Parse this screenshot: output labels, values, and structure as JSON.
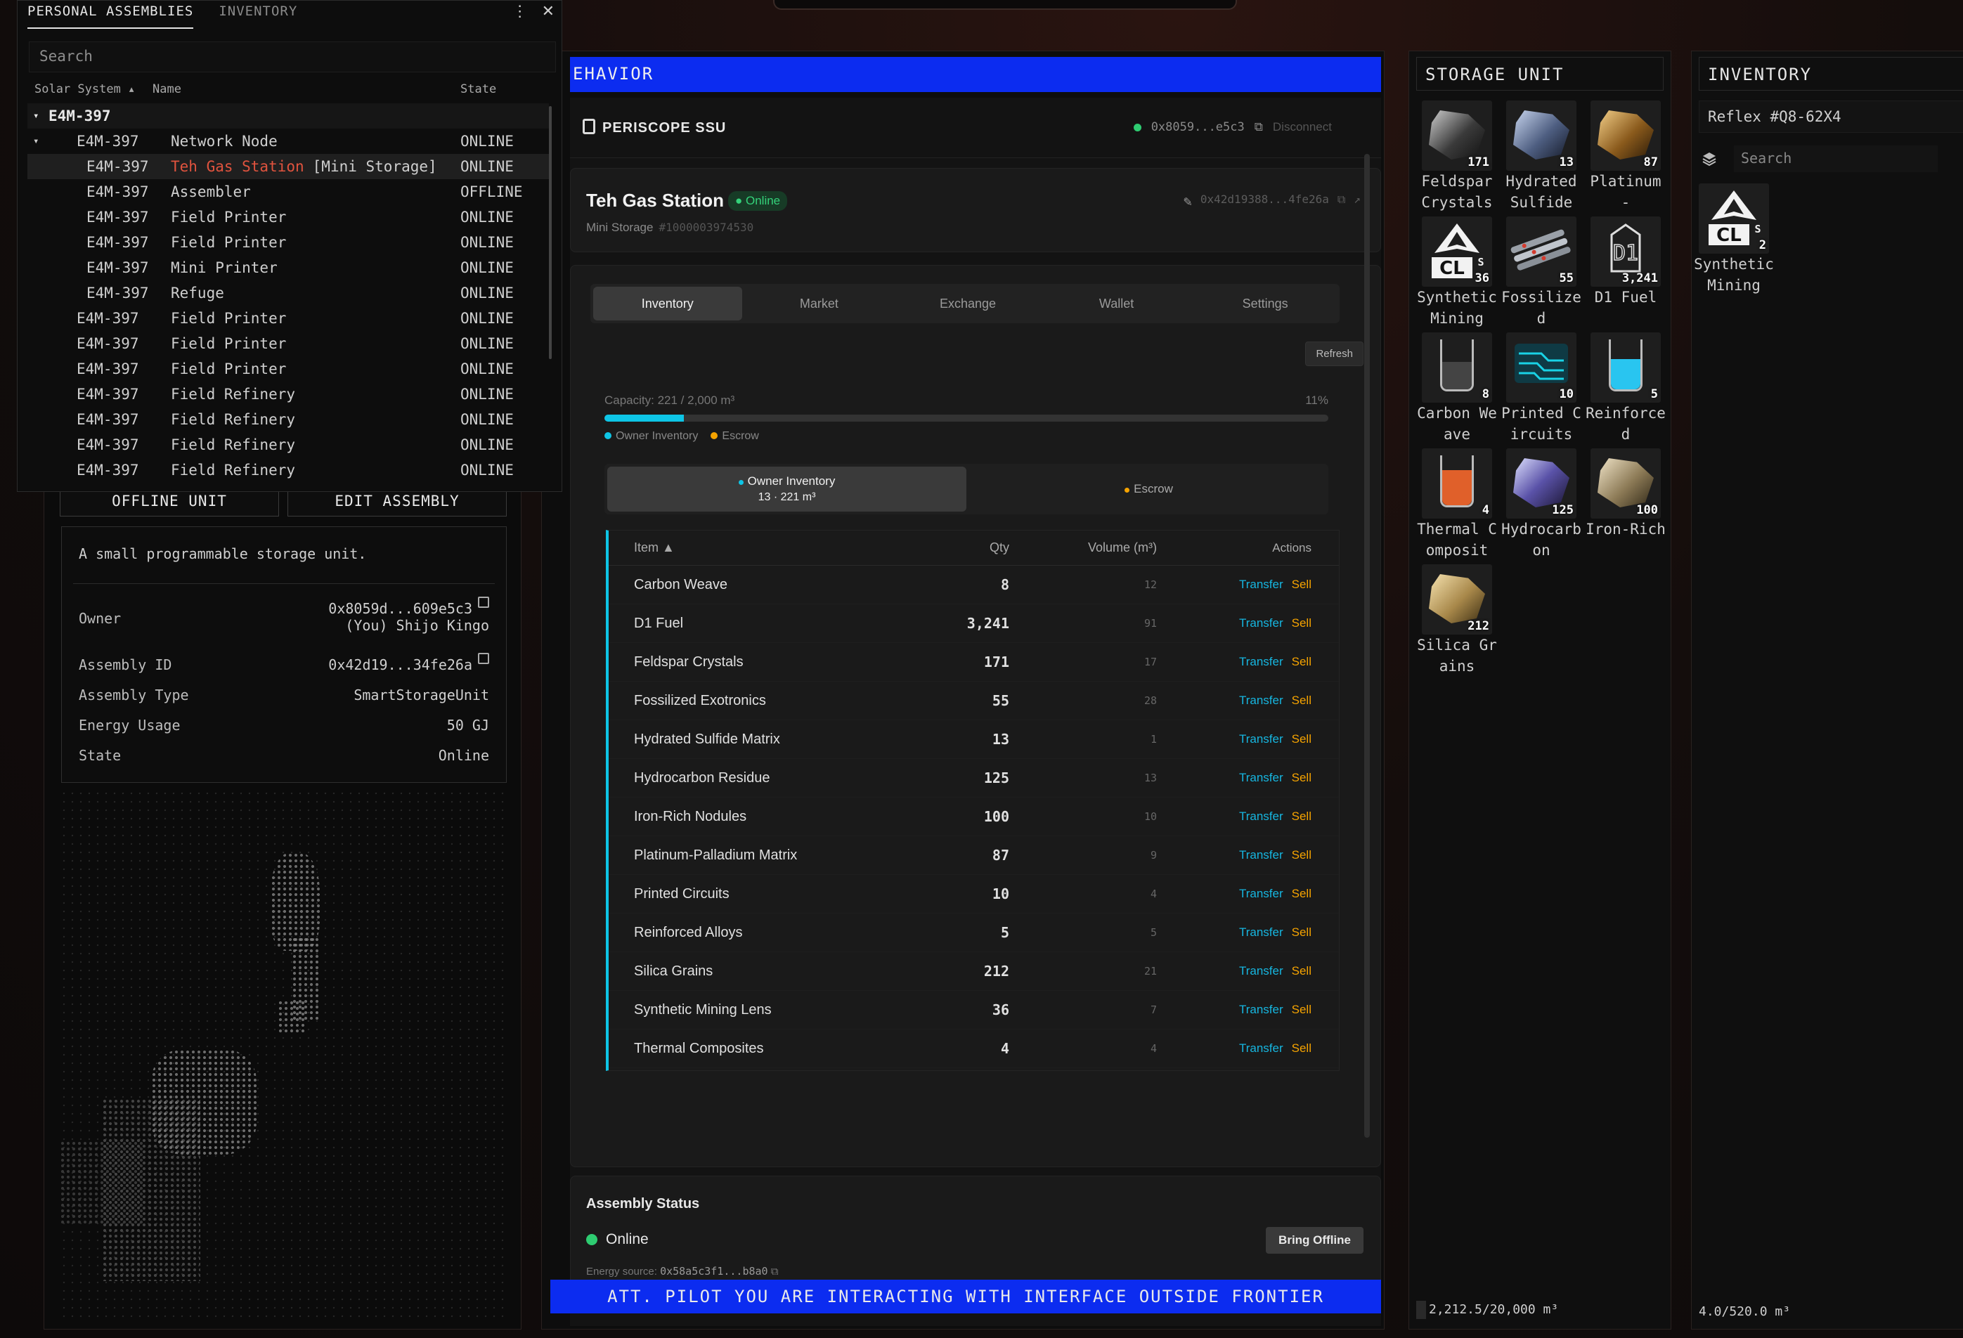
{
  "assemblies_panel": {
    "tabs": [
      "PERSONAL ASSEMBLIES",
      "INVENTORY"
    ],
    "menu_glyph": "⋮",
    "close_glyph": "✕",
    "search_placeholder": "Search",
    "columns": [
      "Solar System ▴",
      "Name",
      "State"
    ],
    "group": "E4M-397",
    "rows": [
      {
        "system": "E4M-397",
        "name": "Network Node",
        "suffix": "",
        "state": "ONLINE",
        "level": 1,
        "expanded": true
      },
      {
        "system": "E4M-397",
        "name": "Teh Gas Station",
        "suffix": "[Mini Storage]",
        "state": "ONLINE",
        "level": 2,
        "selected": true
      },
      {
        "system": "E4M-397",
        "name": "Assembler",
        "suffix": "",
        "state": "OFFLINE",
        "level": 2
      },
      {
        "system": "E4M-397",
        "name": "Field Printer",
        "suffix": "",
        "state": "ONLINE",
        "level": 2
      },
      {
        "system": "E4M-397",
        "name": "Field Printer",
        "suffix": "",
        "state": "ONLINE",
        "level": 2
      },
      {
        "system": "E4M-397",
        "name": "Mini Printer",
        "suffix": "",
        "state": "ONLINE",
        "level": 2
      },
      {
        "system": "E4M-397",
        "name": "Refuge",
        "suffix": "",
        "state": "ONLINE",
        "level": 2
      },
      {
        "system": "E4M-397",
        "name": "Field Printer",
        "suffix": "",
        "state": "ONLINE",
        "level": 1
      },
      {
        "system": "E4M-397",
        "name": "Field Printer",
        "suffix": "",
        "state": "ONLINE",
        "level": 1
      },
      {
        "system": "E4M-397",
        "name": "Field Printer",
        "suffix": "",
        "state": "ONLINE",
        "level": 1
      },
      {
        "system": "E4M-397",
        "name": "Field Refinery",
        "suffix": "",
        "state": "ONLINE",
        "level": 1
      },
      {
        "system": "E4M-397",
        "name": "Field Refinery",
        "suffix": "",
        "state": "ONLINE",
        "level": 1
      },
      {
        "system": "E4M-397",
        "name": "Field Refinery",
        "suffix": "",
        "state": "ONLINE",
        "level": 1
      },
      {
        "system": "E4M-397",
        "name": "Field Refinery",
        "suffix": "",
        "state": "ONLINE",
        "level": 1
      }
    ]
  },
  "left": {
    "offline_unit": "OFFLINE UNIT",
    "edit_assembly": "EDIT ASSEMBLY",
    "description": "A small programmable storage unit.",
    "owner_label": "Owner",
    "owner_addr": "0x8059d...609e5c3",
    "owner_name": "(You) Shijo Kingo",
    "assembly_id_label": "Assembly ID",
    "assembly_id": "0x42d19...34fe26a",
    "assembly_type_label": "Assembly Type",
    "assembly_type": "SmartStorageUnit",
    "energy_label": "Energy Usage",
    "energy": "50 GJ",
    "state_label": "State",
    "state": "Online"
  },
  "center": {
    "behavior_title": "EHAVIOR",
    "dapp_title": "PERISCOPE SSU",
    "wallet_addr": "0x8059...e5c3",
    "disconnect": "Disconnect",
    "station_name": "Teh Gas Station",
    "online_badge": "Online",
    "station_type": "Mini Storage",
    "station_id": "#1000003974530",
    "station_addr": "0x42d19388...4fe26a",
    "tabs": [
      "Inventory",
      "Market",
      "Exchange",
      "Wallet",
      "Settings"
    ],
    "active_tab": "Inventory",
    "refresh": "Refresh",
    "capacity_text": "Capacity: 221 / 2,000 m³",
    "capacity_pct_text": "11%",
    "capacity_fraction": 0.11,
    "legend_owner": "Owner Inventory",
    "legend_escrow": "Escrow",
    "sub_owner_title": "Owner Inventory",
    "sub_owner_detail": "13 · 221 m³",
    "sub_escrow": "Escrow",
    "table_headers": {
      "item": "Item ▲",
      "qty": "Qty",
      "volume": "Volume (m³)",
      "actions": "Actions"
    },
    "action_transfer": "Transfer",
    "action_sell": "Sell",
    "items": [
      {
        "name": "Carbon Weave",
        "qty": "8",
        "vol": "12"
      },
      {
        "name": "D1 Fuel",
        "qty": "3,241",
        "vol": "91"
      },
      {
        "name": "Feldspar Crystals",
        "qty": "171",
        "vol": "17"
      },
      {
        "name": "Fossilized Exotronics",
        "qty": "55",
        "vol": "28"
      },
      {
        "name": "Hydrated Sulfide Matrix",
        "qty": "13",
        "vol": "1"
      },
      {
        "name": "Hydrocarbon Residue",
        "qty": "125",
        "vol": "13"
      },
      {
        "name": "Iron-Rich Nodules",
        "qty": "100",
        "vol": "10"
      },
      {
        "name": "Platinum-Palladium Matrix",
        "qty": "87",
        "vol": "9"
      },
      {
        "name": "Printed Circuits",
        "qty": "10",
        "vol": "4"
      },
      {
        "name": "Reinforced Alloys",
        "qty": "5",
        "vol": "5"
      },
      {
        "name": "Silica Grains",
        "qty": "212",
        "vol": "21"
      },
      {
        "name": "Synthetic Mining Lens",
        "qty": "36",
        "vol": "7"
      },
      {
        "name": "Thermal Composites",
        "qty": "4",
        "vol": "4"
      }
    ],
    "status_title": "Assembly Status",
    "status_value": "Online",
    "bring_offline": "Bring Offline",
    "energy_source_label": "Energy source:",
    "energy_source": "0x58a5c3f1...b8a0",
    "att_banner": "ATT. PILOT YOU ARE INTERACTING WITH INTERFACE OUTSIDE FRONTIER"
  },
  "storage_unit": {
    "title": "STORAGE UNIT",
    "slots": [
      {
        "name": "Feldspar Crystals",
        "qty": "171",
        "icon": "rock-dark"
      },
      {
        "name": "Hydrated Sulfide",
        "qty": "13",
        "icon": "rock-blue"
      },
      {
        "name": "Platinum -",
        "qty": "87",
        "icon": "rock-gold"
      },
      {
        "name": "Synthetic Mining",
        "qty": "36",
        "icon": "synthetic-lens"
      },
      {
        "name": "Fossilized",
        "qty": "55",
        "icon": "fossil-rods"
      },
      {
        "name": "D1 Fuel",
        "qty": "3,241",
        "icon": "fuel-d1"
      },
      {
        "name": "Carbon Weave",
        "qty": "8",
        "icon": "beaker-dark"
      },
      {
        "name": "Printed Circuits",
        "qty": "10",
        "icon": "circuit"
      },
      {
        "name": "Reinforced",
        "qty": "5",
        "icon": "beaker-cyan"
      },
      {
        "name": "Thermal Composit",
        "qty": "4",
        "icon": "beaker-orange"
      },
      {
        "name": "Hydrocarbon",
        "qty": "125",
        "icon": "rock-purple"
      },
      {
        "name": "Iron-Rich",
        "qty": "100",
        "icon": "rock-tan"
      },
      {
        "name": "Silica Grains",
        "qty": "212",
        "icon": "rock-sand"
      }
    ],
    "footer": "2,212.5/20,000 m³"
  },
  "inventory": {
    "title": "INVENTORY",
    "ship": "Reflex #Q8-62X4",
    "search_placeholder": "Search",
    "slots": [
      {
        "name": "Synthetic Mining",
        "qty": "2",
        "icon": "synthetic-lens"
      }
    ],
    "footer": "4.0/520.0 m³"
  }
}
